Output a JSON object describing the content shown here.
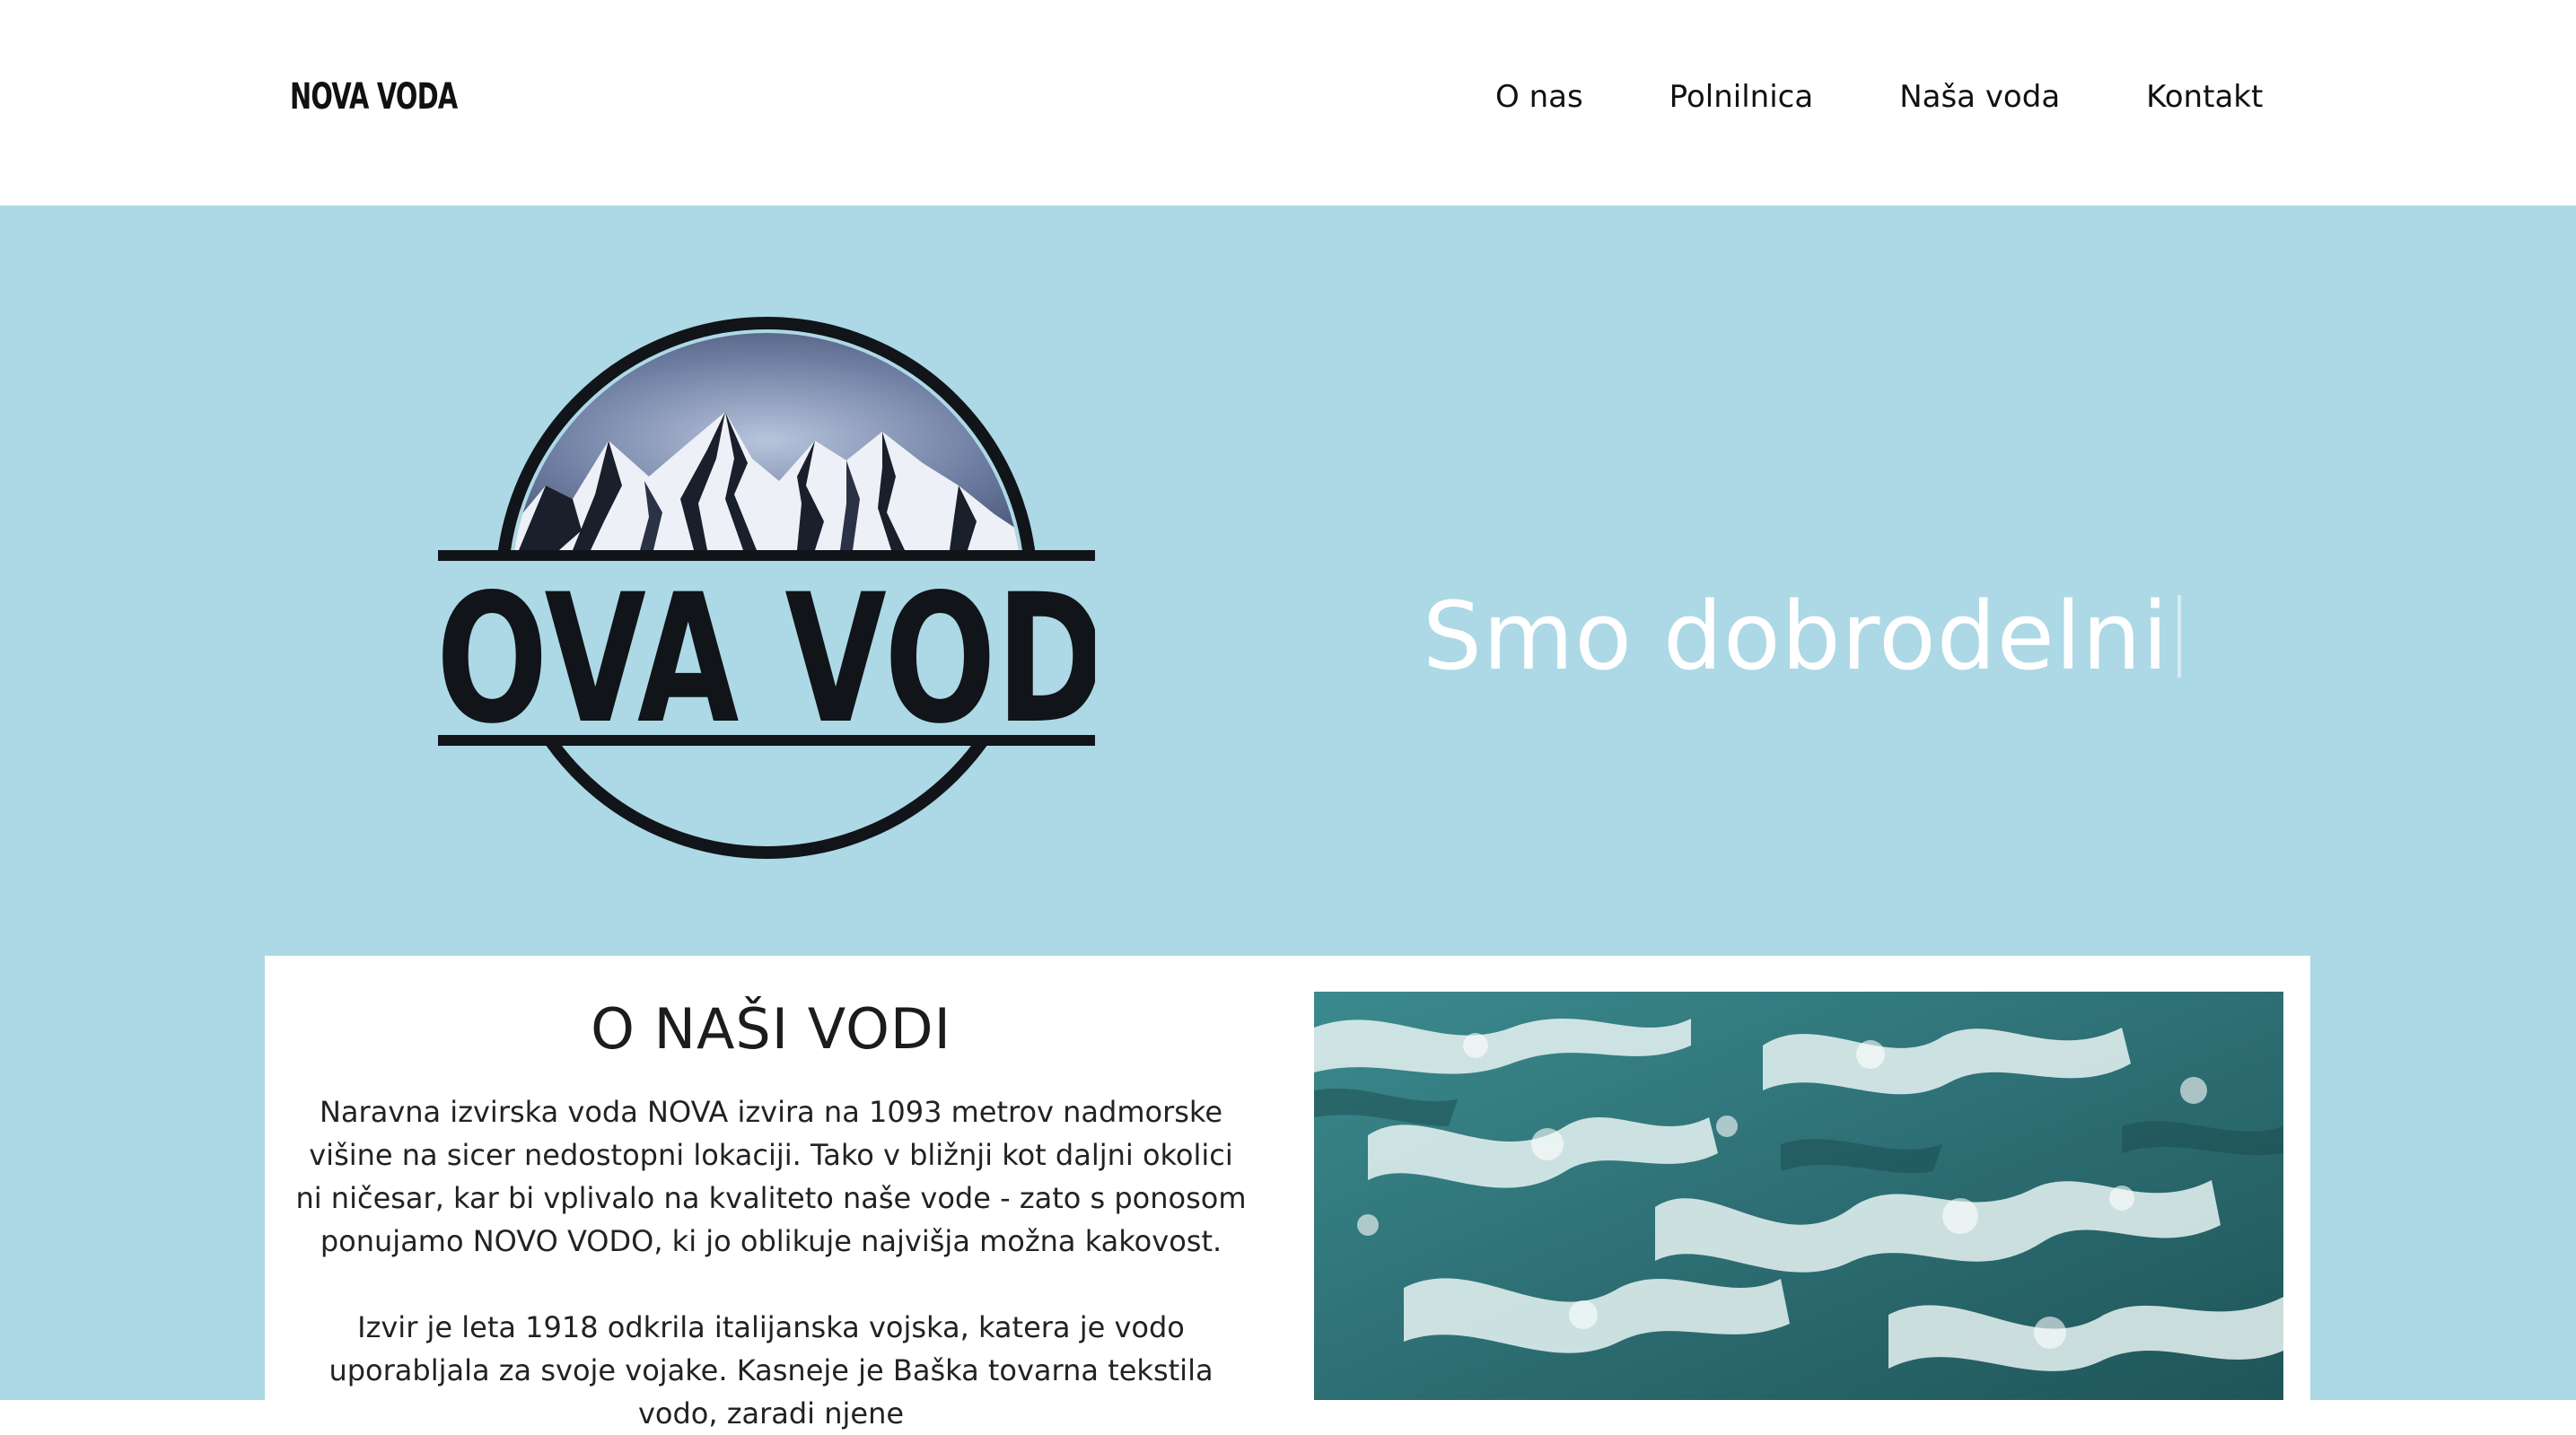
{
  "header": {
    "brand": "NOVA VODA",
    "nav": [
      {
        "label": "O nas"
      },
      {
        "label": "Polnilnica"
      },
      {
        "label": "Naša voda"
      },
      {
        "label": "Kontakt"
      }
    ]
  },
  "hero": {
    "logo_text": "NOVA VODA",
    "tagline": "Smo dobrodelni",
    "background_color": "#add8e6"
  },
  "about": {
    "title": "O NAŠI VODI",
    "paragraphs": [
      "Naravna izvirska voda NOVA izvira na 1093 metrov nadmorske višine na sicer nedostopni lokaciji. Tako v bližnji kot daljni okolici ni ničesar, kar bi vplivalo na kvaliteto naše vode - zato s ponosom ponujamo NOVO VODO, ki jo oblikuje najvišja možna kakovost.",
      "Izvir je leta 1918 odkrila italijanska vojska, katera je vodo uporabljala za svoje vojake. Kasneje je Baška tovarna tekstila vodo, zaradi njene"
    ],
    "image_icon": "rushing-water-photo"
  }
}
